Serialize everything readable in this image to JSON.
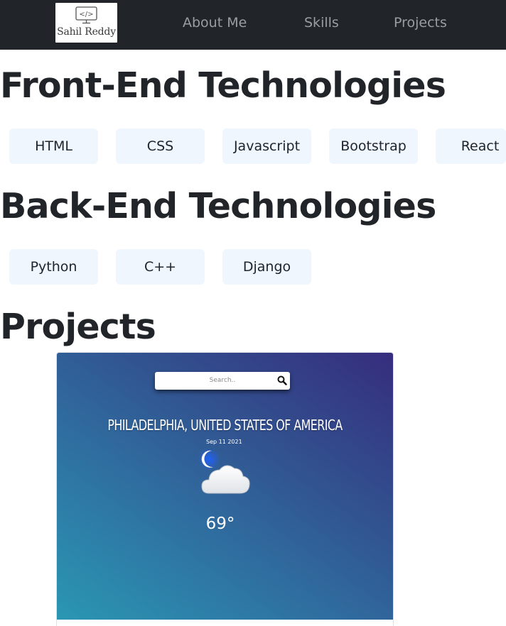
{
  "navbar": {
    "logo_text": "Sahil Reddy",
    "logo_icon": "code-monitor-icon",
    "links": [
      "About Me",
      "Skills",
      "Projects"
    ]
  },
  "frontend": {
    "title": "Front-End Technologies",
    "items": [
      "HTML",
      "CSS",
      "Javascript",
      "Bootstrap",
      "React"
    ]
  },
  "backend": {
    "title": "Back-End Technologies",
    "items": [
      "Python",
      "C++",
      "Django"
    ]
  },
  "projects": {
    "title": "Projects",
    "weather_app": {
      "search_placeholder": "Search..",
      "city": "PHILADELPHIA, UNITED STATES OF AMERICA",
      "date": "Sep 11 2021",
      "temperature": "69°",
      "icon": "moon-cloud-icon"
    }
  },
  "colors": {
    "navbar_bg": "#212529",
    "nav_link": "#9a9da1",
    "pill_bg": "#eff6fd",
    "card_gradient_start": "#2a97b3",
    "card_gradient_end": "#362d7e"
  }
}
